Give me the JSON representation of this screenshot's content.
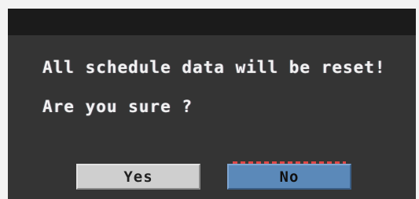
{
  "dialog": {
    "message_line_1": "All schedule data will be reset!",
    "message_line_2": "Are you sure ?"
  },
  "buttons": {
    "yes_label": "Yes",
    "no_label": "No"
  },
  "colors": {
    "dialog_background": "#343434",
    "top_bar": "#1b1b1b",
    "yes_button": "#cfcfcf",
    "no_button_selected": "#5b89b9",
    "text": "#f2f2f2"
  }
}
